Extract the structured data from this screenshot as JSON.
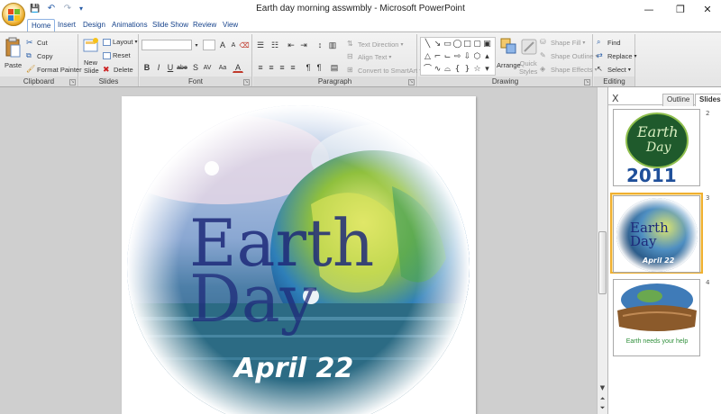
{
  "window": {
    "title": "Earth day morning asswmbly - Microsoft PowerPoint",
    "minimize": "—",
    "restore": "❐",
    "close": "✕"
  },
  "qat": {
    "save_icon": "💾",
    "undo_icon": "↶",
    "redo_icon": "↷",
    "more_icon": "▾"
  },
  "tabs": [
    "Home",
    "Insert",
    "Design",
    "Animations",
    "Slide Show",
    "Review",
    "View"
  ],
  "ribbon": {
    "clipboard": {
      "label": "Clipboard",
      "paste": "Paste",
      "cut": "Cut",
      "copy": "Copy",
      "format_painter": "Format Painter"
    },
    "slides": {
      "label": "Slides",
      "new_slide_line1": "New",
      "new_slide_line2": "Slide",
      "layout": "Layout",
      "reset": "Reset",
      "delete": "Delete"
    },
    "font": {
      "label": "Font",
      "bold": "B",
      "italic": "I",
      "underline": "U",
      "strike": "abe",
      "shadow": "S",
      "char_spacing": "AV",
      "change_case": "Aa",
      "grow": "A",
      "shrink": "A",
      "color": "A"
    },
    "paragraph": {
      "label": "Paragraph",
      "text_direction": "Text Direction",
      "align_text": "Align Text",
      "convert_smartart": "Convert to SmartArt"
    },
    "drawing": {
      "label": "Drawing",
      "arrange": "Arrange",
      "quick_styles_line1": "Quick",
      "quick_styles_line2": "Styles",
      "shape_fill": "Shape Fill",
      "shape_outline": "Shape Outline",
      "shape_effects": "Shape Effects"
    },
    "editing": {
      "label": "Editing",
      "find": "Find",
      "replace": "Replace",
      "select": "Select"
    }
  },
  "slide": {
    "title_line1": "Earth",
    "title_line2": "Day",
    "date": "April 22"
  },
  "panel": {
    "close": "X",
    "tab_outline": "Outline",
    "tab_slides": "Slides",
    "thumbs": [
      {
        "num": "2",
        "line1": "Earth",
        "line2": "Day",
        "year": "2011"
      },
      {
        "num": "3",
        "line1": "Earth",
        "line2": "Day",
        "date": "April 22"
      },
      {
        "num": "4",
        "caption": "Earth needs your help"
      }
    ]
  },
  "colors": {
    "accent": "#15428b",
    "ribbon_bg": "#e9e9e9",
    "work_bg": "#cfcfcf",
    "selected_thumb": "#f0b030"
  }
}
